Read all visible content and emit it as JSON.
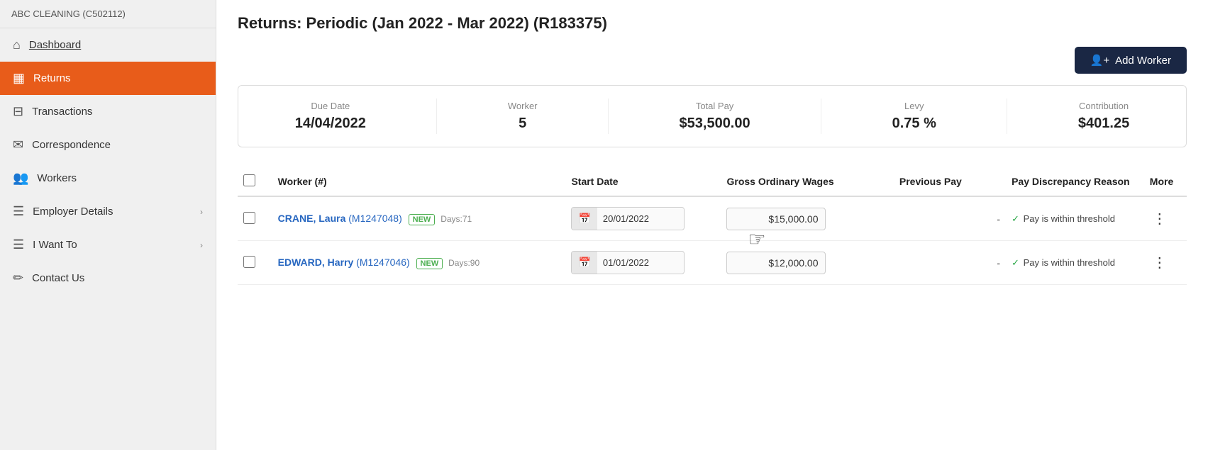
{
  "company": {
    "name": "ABC CLEANING (C502112)"
  },
  "sidebar": {
    "items": [
      {
        "id": "dashboard",
        "label": "Dashboard",
        "icon": "⌂",
        "active": false,
        "hasChevron": false,
        "underline": true
      },
      {
        "id": "returns",
        "label": "Returns",
        "icon": "▦",
        "active": true,
        "hasChevron": false,
        "underline": false
      },
      {
        "id": "transactions",
        "label": "Transactions",
        "icon": "⊟",
        "active": false,
        "hasChevron": false,
        "underline": false
      },
      {
        "id": "correspondence",
        "label": "Correspondence",
        "icon": "✉",
        "active": false,
        "hasChevron": false,
        "underline": false
      },
      {
        "id": "workers",
        "label": "Workers",
        "icon": "👥",
        "active": false,
        "hasChevron": false,
        "underline": false
      },
      {
        "id": "employer-details",
        "label": "Employer Details",
        "icon": "☰",
        "active": false,
        "hasChevron": true,
        "underline": false
      },
      {
        "id": "i-want-to",
        "label": "I Want To",
        "icon": "☰",
        "active": false,
        "hasChevron": true,
        "underline": false
      },
      {
        "id": "contact-us",
        "label": "Contact Us",
        "icon": "✏",
        "active": false,
        "hasChevron": false,
        "underline": false
      }
    ]
  },
  "page": {
    "title": "Returns: Periodic (Jan 2022 - Mar 2022) (R183375)"
  },
  "toolbar": {
    "add_worker_label": "Add Worker"
  },
  "summary": {
    "due_date_label": "Due Date",
    "due_date_value": "14/04/2022",
    "worker_label": "Worker",
    "worker_value": "5",
    "total_pay_label": "Total Pay",
    "total_pay_value": "$53,500.00",
    "levy_label": "Levy",
    "levy_value": "0.75 %",
    "contribution_label": "Contribution",
    "contribution_value": "$401.25"
  },
  "table": {
    "columns": [
      {
        "id": "check",
        "label": ""
      },
      {
        "id": "worker",
        "label": "Worker (#)"
      },
      {
        "id": "startdate",
        "label": "Start Date"
      },
      {
        "id": "wages",
        "label": "Gross Ordinary Wages"
      },
      {
        "id": "prevpay",
        "label": "Previous Pay"
      },
      {
        "id": "discrepancy",
        "label": "Pay Discrepancy Reason"
      },
      {
        "id": "more",
        "label": "More"
      }
    ],
    "rows": [
      {
        "id": "row-1",
        "name": "CRANE, Laura",
        "member_id": "M1247048",
        "badge": "NEW",
        "days": "Days:71",
        "start_date": "20/01/2022",
        "wages": "$15,000.00",
        "prev_pay": "-",
        "discrepancy_check": "✓",
        "discrepancy_text": "Pay is within threshold"
      },
      {
        "id": "row-2",
        "name": "EDWARD, Harry",
        "member_id": "M1247046",
        "badge": "NEW",
        "days": "Days:90",
        "start_date": "01/01/2022",
        "wages": "$12,000.00",
        "prev_pay": "-",
        "discrepancy_check": "✓",
        "discrepancy_text": "Pay is within threshold"
      }
    ]
  }
}
